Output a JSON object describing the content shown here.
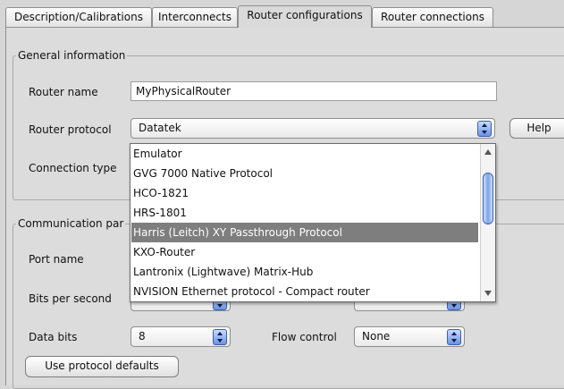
{
  "tabs": [
    {
      "label": "Description/Calibrations",
      "active": false
    },
    {
      "label": "Interconnects",
      "active": false
    },
    {
      "label": "Router configurations",
      "active": true
    },
    {
      "label": "Router connections",
      "active": false
    }
  ],
  "general": {
    "title": "General information",
    "router_name_label": "Router name",
    "router_name_value": "MyPhysicalRouter",
    "router_protocol_label": "Router protocol",
    "router_protocol_value": "Datatek",
    "connection_type_label": "Connection type",
    "help_label": "Help"
  },
  "protocol_dropdown": {
    "options": [
      "Emulator",
      "GVG 7000 Native Protocol",
      "HCO-1821",
      "HRS-1801",
      "Harris (Leitch) XY Passthrough Protocol",
      "KXO-Router",
      "Lantronix (Lightwave) Matrix-Hub",
      "NVISION Ethernet protocol - Compact router"
    ],
    "selected": "Harris (Leitch) XY Passthrough Protocol"
  },
  "communication": {
    "title": "Communication parameters",
    "title_visible": "Communication par",
    "port_name_label": "Port name",
    "bits_per_second_label": "Bits per second",
    "data_bits_label": "Data bits",
    "data_bits_value": "8",
    "flow_control_label": "Flow control",
    "flow_control_value": "None",
    "use_defaults_label": "Use protocol defaults"
  },
  "colors": {
    "panel_bg": "#dcdcdc",
    "selection_bg": "#7e7e7e",
    "spinner_blue": "#6b93e0"
  }
}
